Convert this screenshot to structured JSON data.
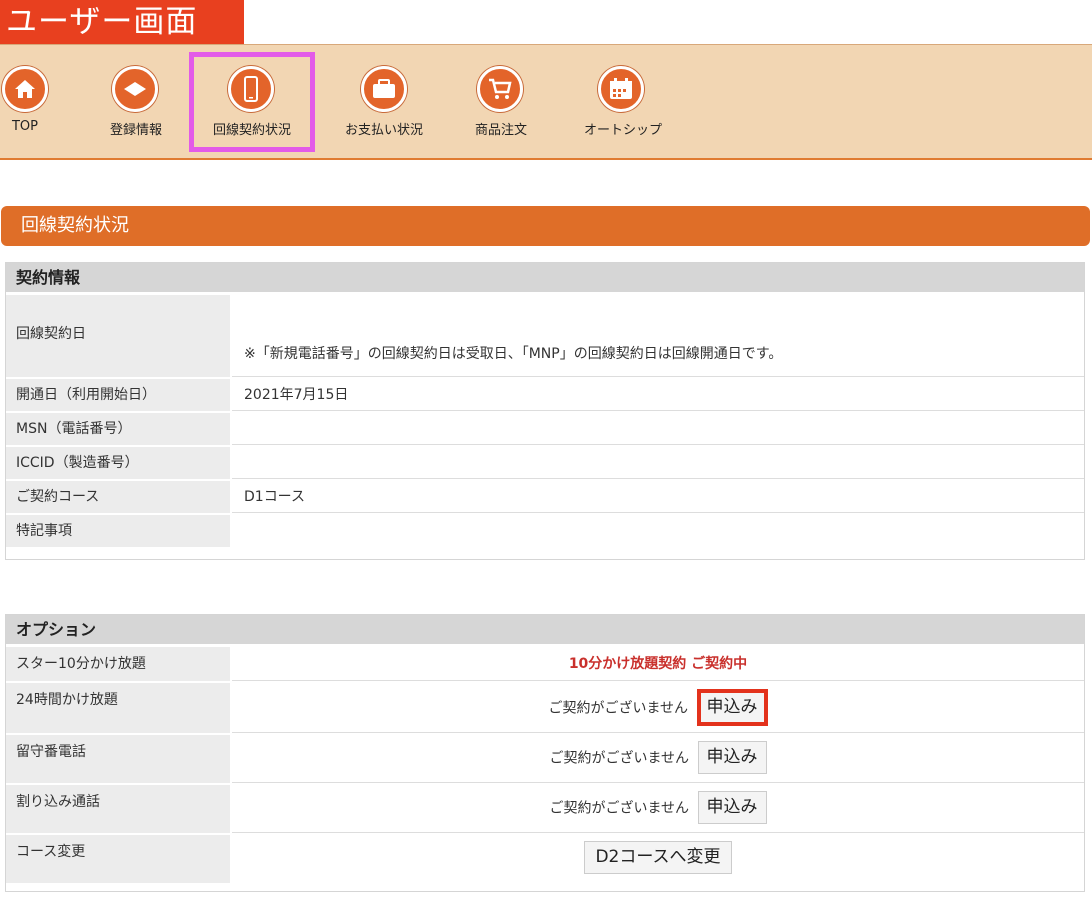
{
  "page_label": "ユーザー画面",
  "nav": {
    "items": [
      {
        "label": "TOP",
        "icon": "home-icon"
      },
      {
        "label": "登録情報",
        "icon": "id-card-icon"
      },
      {
        "label": "回線契約状況",
        "icon": "smartphone-icon"
      },
      {
        "label": "お支払い状況",
        "icon": "wallet-icon"
      },
      {
        "label": "商品注文",
        "icon": "cart-icon"
      },
      {
        "label": "オートシップ",
        "icon": "calendar-icon"
      }
    ],
    "active_index": 2
  },
  "section_title": "回線契約状況",
  "contract": {
    "header": "契約情報",
    "rows": [
      {
        "label": "回線契約日",
        "value": "",
        "note": "※「新規電話番号」の回線契約日は受取日、「MNP」の回線契約日は回線開通日です。"
      },
      {
        "label": "開通日（利用開始日）",
        "value": "2021年7月15日"
      },
      {
        "label": "MSN（電話番号）",
        "value": ""
      },
      {
        "label": "ICCID（製造番号）",
        "value": ""
      },
      {
        "label": "ご契約コース",
        "value": "D1コース"
      },
      {
        "label": "特記事項",
        "value": ""
      }
    ]
  },
  "options": {
    "header": "オプション",
    "rows": [
      {
        "label": "スター10分かけ放題",
        "status": "10分かけ放題契約 ご契約中"
      },
      {
        "label": "24時間かけ放題",
        "status": "ご契約がございません",
        "button": "申込み"
      },
      {
        "label": "留守番電話",
        "status": "ご契約がございません",
        "button": "申込み"
      },
      {
        "label": "割り込み通話",
        "status": "ご契約がございません",
        "button": "申込み"
      },
      {
        "label": "コース変更",
        "button": "D2コースへ変更"
      }
    ]
  },
  "colors": {
    "title_label": "#e8401f",
    "nav_bg": "#f2d6b3",
    "section_bar": "#df6e28",
    "highlight_nav": "#e35be8",
    "highlight_button": "#e3321c",
    "active_status": "#c9302c"
  }
}
